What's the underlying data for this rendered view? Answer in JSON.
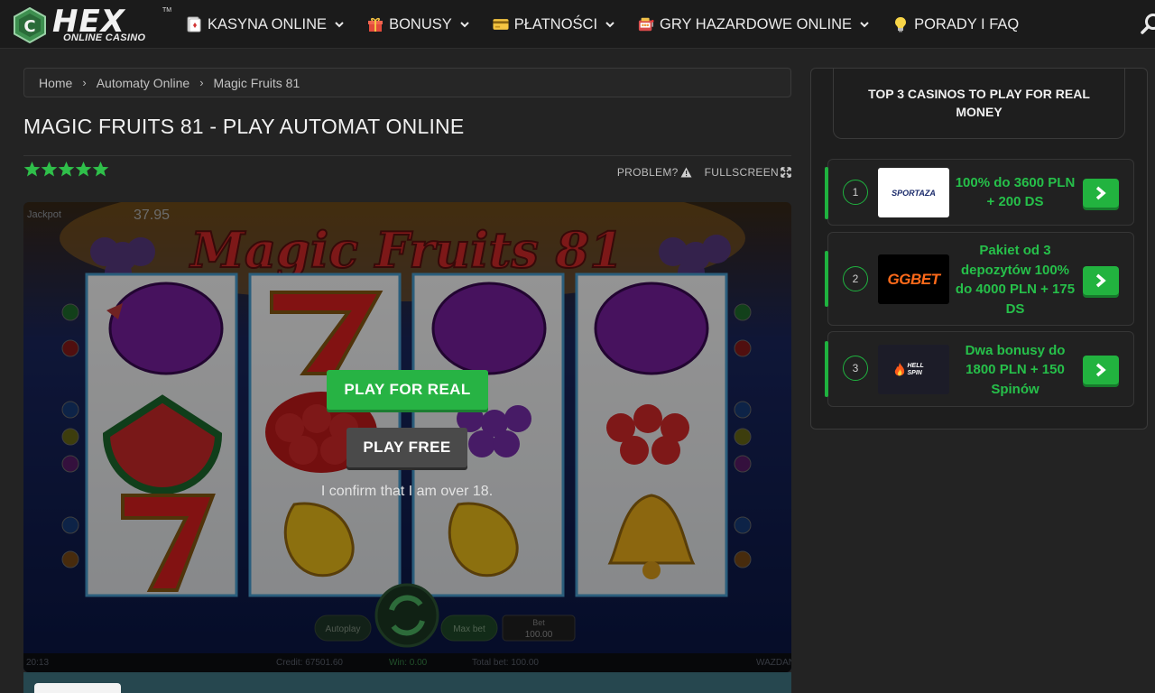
{
  "header": {
    "logo_text": "HEX",
    "logo_sub": "ONLINE CASINO",
    "logo_tm": "TM",
    "nav": [
      {
        "label": "KASYNA ONLINE",
        "icon": "cards-icon"
      },
      {
        "label": "BONUSY",
        "icon": "gift-icon"
      },
      {
        "label": "PŁATNOŚCI",
        "icon": "credit-card-icon"
      },
      {
        "label": "GRY HAZARDOWE ONLINE",
        "icon": "slot-machine-icon"
      },
      {
        "label": "PORADY I FAQ",
        "icon": "lightbulb-icon"
      }
    ]
  },
  "breadcrumb": {
    "items": [
      "Home",
      "Automaty Online",
      "Magic Fruits 81"
    ],
    "separator": "›"
  },
  "page": {
    "title": "MAGIC FRUITS 81 - PLAY AUTOMAT ONLINE",
    "rating": 5,
    "rating_max": 5,
    "star_color": "#2fbf4a",
    "problem_label": "PROBLEM?",
    "fullscreen_label": "FULLSCREEN"
  },
  "game": {
    "logo_text": "Magic Fruits 81",
    "jackpot_label": "Jackpot",
    "jackpot_value": "37.95",
    "play_real_label": "PLAY FOR REAL",
    "play_free_label": "PLAY FREE",
    "confirm_text": "I confirm that I am over 18.",
    "autoplay_label": "Autoplay",
    "maxbet_label": "Max bet",
    "bet_label": "Bet",
    "bet_value": "100.00",
    "credit_text": "Credit: 67501.60",
    "win_text": "Win: 0.00",
    "total_bet_text": "Total bet: 100.00",
    "clock_text": "20:13",
    "provider_text": "WAZDAN"
  },
  "sidebar": {
    "title": "TOP 3 CASINOS TO PLAY FOR REAL MONEY",
    "casinos": [
      {
        "rank": "1",
        "logo": "SPORTAZA",
        "bonus": "100% do 3600 PLN + 200 DS",
        "accent": "#1fb23f"
      },
      {
        "rank": "2",
        "logo": "GGBET",
        "bonus": "Pakiet od 3 depozytów 100% do 4000 PLN + 175 DS",
        "accent": "#1fb23f"
      },
      {
        "rank": "3",
        "logo": "HELL SPIN",
        "bonus": "Dwa bonusy do 1800 PLN + 150 Spinów",
        "accent": "#1fb23f"
      }
    ]
  }
}
